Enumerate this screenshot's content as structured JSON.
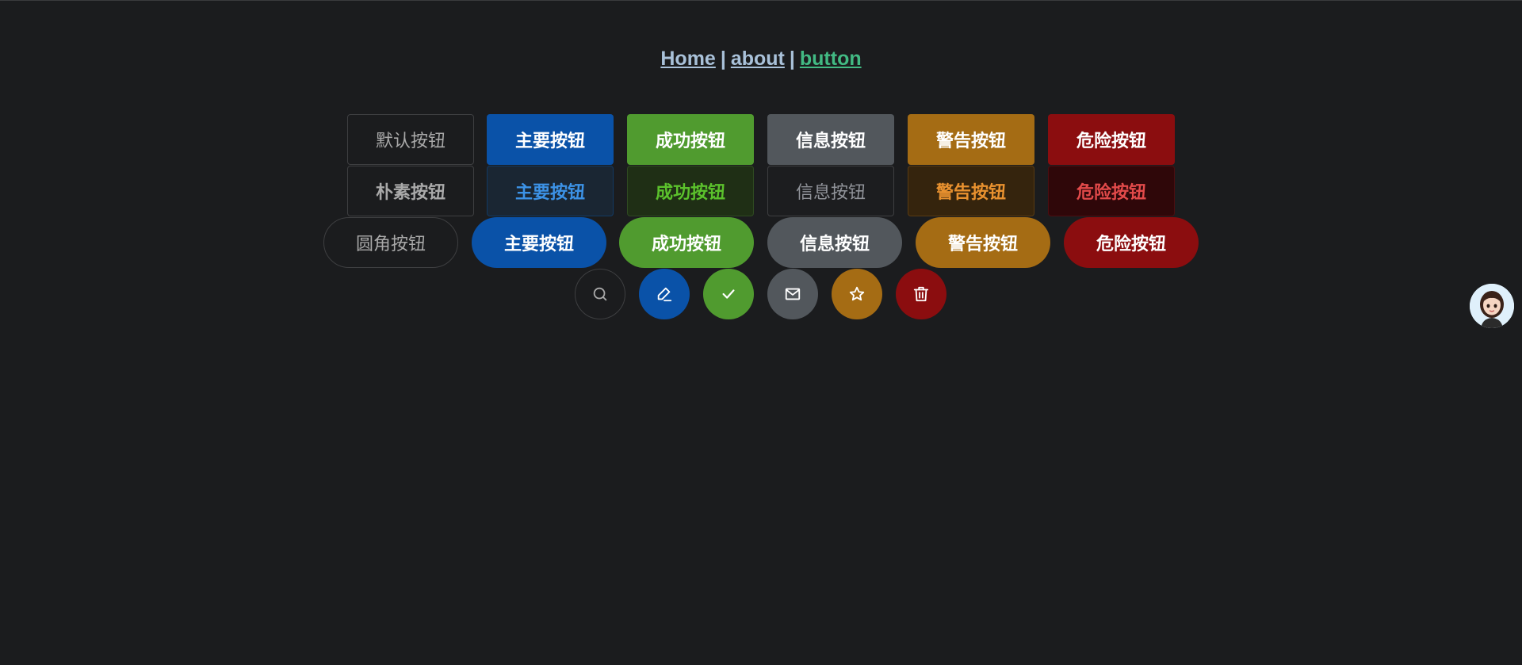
{
  "nav": {
    "home": "Home",
    "about": "about",
    "button": "button",
    "separator": "|"
  },
  "rows": {
    "solid": [
      "默认按钮",
      "主要按钮",
      "成功按钮",
      "信息按钮",
      "警告按钮",
      "危险按钮"
    ],
    "plain": [
      "朴素按钮",
      "主要按钮",
      "成功按钮",
      "信息按钮",
      "警告按钮",
      "危险按钮"
    ],
    "round": [
      "圆角按钮",
      "主要按钮",
      "成功按钮",
      "信息按钮",
      "警告按钮",
      "危险按钮"
    ]
  },
  "circle_icons": [
    "search-icon",
    "edit-icon",
    "check-icon",
    "mail-icon",
    "star-icon",
    "delete-icon"
  ],
  "colors": {
    "background": "#1b1c1e",
    "primary": "#0a52a8",
    "success": "#509b2f",
    "info": "#52575c",
    "warning": "#a56c14",
    "danger": "#8b0d0f",
    "nav_link": "#a9c1d9",
    "nav_active": "#42b983"
  }
}
